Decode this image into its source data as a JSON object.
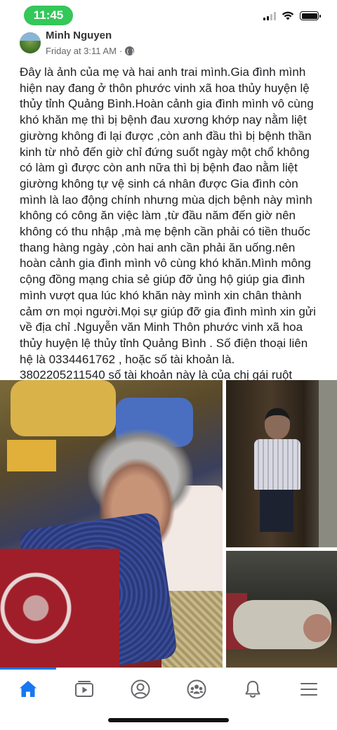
{
  "status_bar": {
    "time": "11:45"
  },
  "post": {
    "author": "Minh Nguyen",
    "timestamp": "Friday at 3:11 AM",
    "separator": "·",
    "privacy_icon": "globe-icon",
    "text": "Đây là ảnh của mẹ và hai anh trai mình.Gia đình mình hiện nay đang ở thôn phước vinh xã hoa thủy huyện lệ thủy tỉnh Quảng Bình.Hoàn cảnh gia đình mình vô cùng khó khăn mẹ thì bị bệnh đau xương khớp nay nằm liệt giường không đi lại được ,còn anh đầu thì bị bệnh thần kinh từ nhỏ đến giờ chỉ đứng suốt ngày một chổ không có làm gì được còn anh nữa thì bị bệnh đao nằm liệt giường không tự vệ sinh cá nhân được Gia đình còn mình là lao động chính nhưng mùa dịch bệnh này mình không có công ăn việc làm ,từ đầu năm đến giờ nên không có thu nhập ,mà mẹ bệnh cần phải có tiền thuốc thang hàng ngày ,còn hai anh cần phải ăn uống.nên hoàn cảnh gia đình mình vô cùng khó khăn.Mình mông cộng đồng mạng chia sẻ giúp đỡ ủng hộ giúp gia đình mình vượt qua lúc khó khăn này mình xin chân thành cảm ơn mọi người.Mọi sự giúp đỡ gia đình mình xin gửi về địa chỉ .Nguyễn văn Minh Thôn phước vinh xã hoa thủy huyện lệ thủy tỉnh Quảng Bình . Số điện thoại liên hệ là 0334461762 , hoặc số tài khoản là. 3802205211540 số tài khoản này là của chị gái ruột mình"
  },
  "tab_bar": {
    "tabs": [
      {
        "icon": "home-icon",
        "active": true
      },
      {
        "icon": "watch-icon",
        "active": false
      },
      {
        "icon": "profile-icon",
        "active": false
      },
      {
        "icon": "groups-icon",
        "active": false
      },
      {
        "icon": "notifications-bell-icon",
        "active": false
      },
      {
        "icon": "menu-icon",
        "active": false
      }
    ],
    "active_color": "#1877f2",
    "inactive_color": "#65676b"
  }
}
